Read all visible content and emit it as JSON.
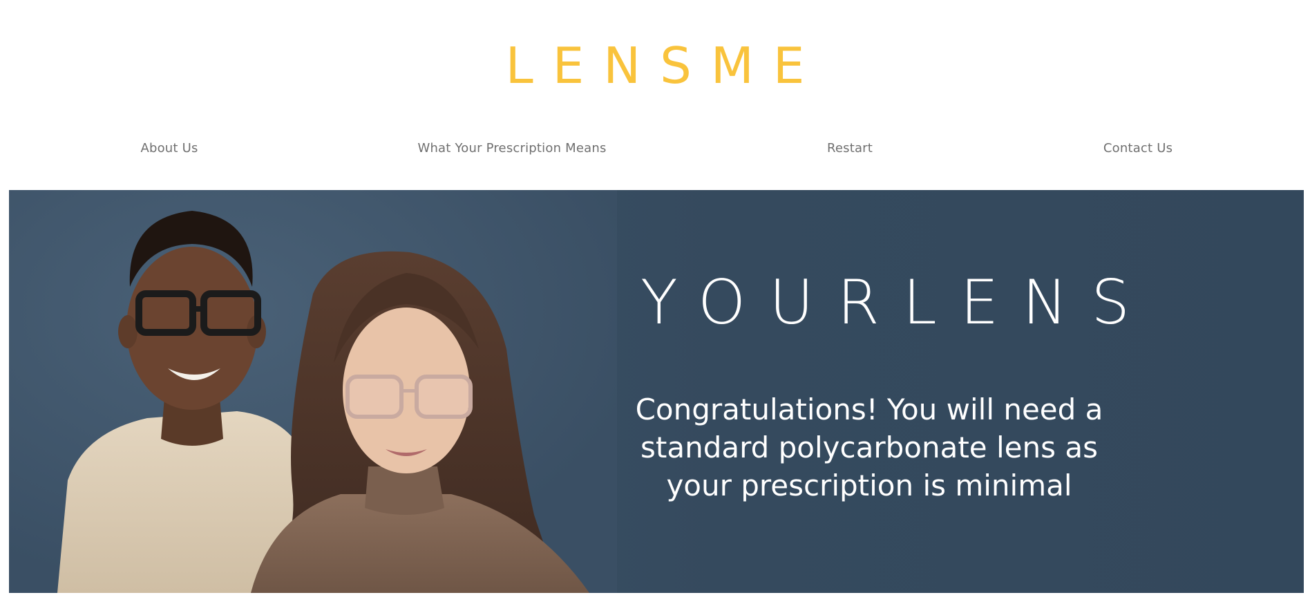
{
  "brand": {
    "logo_text": "LENSME",
    "logo_color": "#F9C33C"
  },
  "nav": {
    "items": [
      {
        "label": "About Us"
      },
      {
        "label": "What Your Prescription Means"
      },
      {
        "label": "Restart"
      },
      {
        "label": "Contact Us"
      }
    ]
  },
  "hero": {
    "background_color": "#354a5e",
    "title": "YOURLENS",
    "message": "Congratulations! You will need a standard polycarbonate lens as your prescription is minimal",
    "image_icon": "people-wearing-glasses-photo"
  }
}
